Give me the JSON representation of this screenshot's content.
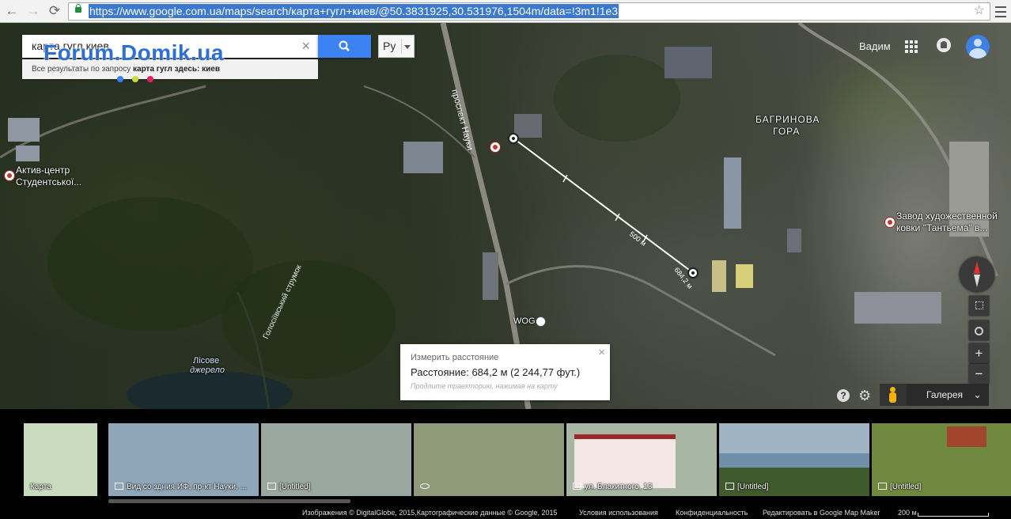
{
  "browser": {
    "url": "https://www.google.com.ua/maps/search/карта+гугл+киев/@50.3831925,30.531976,1504m/data=!3m1!1e3",
    "back_label": "←",
    "forward_label": "→",
    "reload_label": "⟳"
  },
  "search": {
    "query": "карта гугл киев",
    "clear_label": "×",
    "language": "Ру",
    "results_prefix": "Все результаты по запросу",
    "results_query": "карта гугл здесь: киев"
  },
  "watermark": "Forum.Domik.ua",
  "account": {
    "name": "Вадим"
  },
  "map_labels": {
    "poi_left": "Актив-центр",
    "poi_left_2": "Студентської...",
    "street": "проспект Науки",
    "district": "БАГРИНОВА",
    "district_2": "ГОРА",
    "poi_right": "Завод художественной",
    "poi_right_2": "ковки \"Тантьема\" в...",
    "stream": "Голосіївський струмок",
    "spring": "Лісове",
    "spring_2": "джерело",
    "gas_station": "WOG",
    "measure_500": "500 м",
    "measure_end": "684,2 м"
  },
  "measure": {
    "title": "Измерить расстояние",
    "distance": "Расстояние: 684,2 м (2 244,77 фут.)",
    "hint": "Продлите траекторию, нажимая на карту",
    "close_label": "×"
  },
  "controls": {
    "zoom_in": "+",
    "zoom_out": "−",
    "help": "?",
    "gallery": "Галерея",
    "gallery_toggle": "⌄"
  },
  "gallery": [
    {
      "caption": "Карта",
      "kind": "map",
      "bg": "#c9dcc0"
    },
    {
      "caption": "Вид со здния ИФ, пр-кт Науки, ...",
      "kind": "photo",
      "bg": "#8fa6b9"
    },
    {
      "caption": "[Untitled]",
      "kind": "photo",
      "bg": "#9aa7a0"
    },
    {
      "caption": "",
      "kind": "pano",
      "bg": "#8e9a7a"
    },
    {
      "caption": "ул. Блакитного, 13",
      "kind": "photo",
      "bg": "#a8b6a4"
    },
    {
      "caption": "[Untitled]",
      "kind": "photo",
      "bg": "#9fb3c4"
    },
    {
      "caption": "[Untitled]",
      "kind": "photo",
      "bg": "#6f8a3f"
    }
  ],
  "footer": {
    "imagery": "Изображения © DigitalGlobe, 2015,Картографические данные © Google, 2015",
    "terms": "Условия использования",
    "privacy": "Конфиденциальность",
    "edit": "Редактировать в Google Map Maker",
    "scale": "200 м"
  },
  "colors": {
    "accent": "#3d82f3",
    "url_highlight": "#3b78d0",
    "watermark": "#2c6fd5",
    "poi_marker": "#c0392b",
    "compass_north": "#dd3333"
  }
}
